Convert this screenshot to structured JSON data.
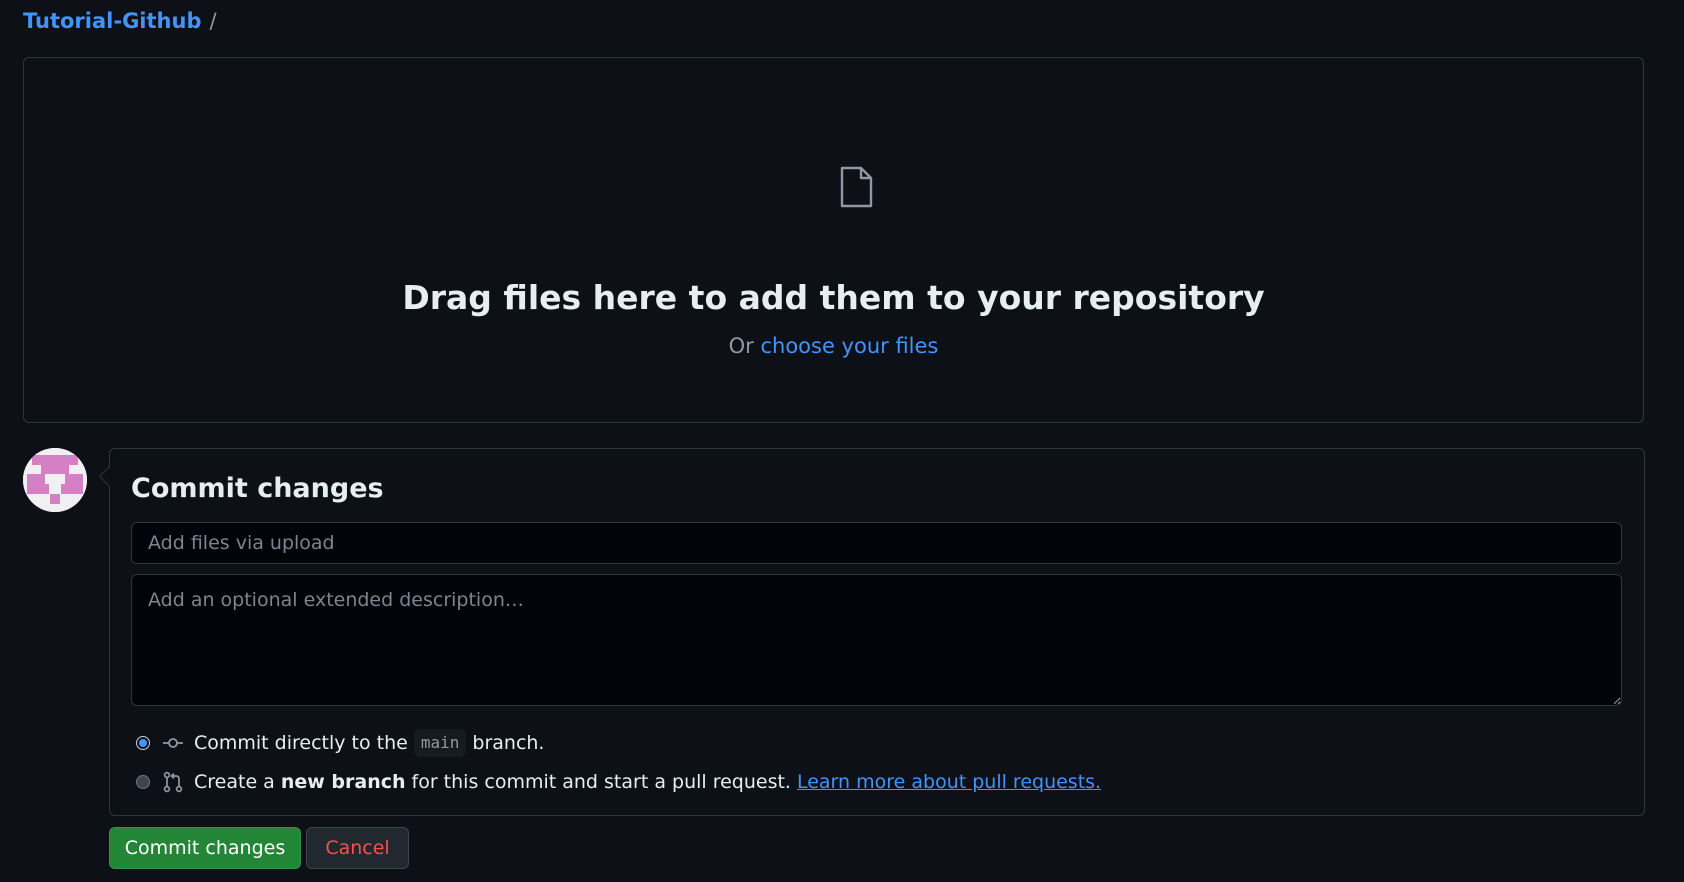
{
  "breadcrumb": {
    "repo": "Tutorial-Github",
    "separator": "/"
  },
  "dropzone": {
    "headline": "Drag files here to add them to your repository",
    "or_text": "Or",
    "choose_link": "choose your files",
    "icon": "file-icon"
  },
  "commit": {
    "title": "Commit changes",
    "summary_placeholder": "Add files via upload",
    "summary_value": "",
    "description_placeholder": "Add an optional extended description…",
    "description_value": "",
    "option_direct": {
      "prefix": "Commit directly to the",
      "branch": "main",
      "suffix": "branch.",
      "checked": true,
      "icon": "git-commit-icon"
    },
    "option_new_branch": {
      "prefix": "Create a",
      "bold": "new branch",
      "suffix": "for this commit and start a pull request.",
      "link": "Learn more about pull requests.",
      "checked": false,
      "icon": "git-pull-request-icon"
    }
  },
  "buttons": {
    "commit_label": "Commit changes",
    "cancel_label": "Cancel"
  },
  "colors": {
    "background": "#0d1117",
    "link": "#4493f8",
    "primary_button": "#238636",
    "danger_text": "#f85149",
    "avatar_pink": "#d57fc4"
  }
}
